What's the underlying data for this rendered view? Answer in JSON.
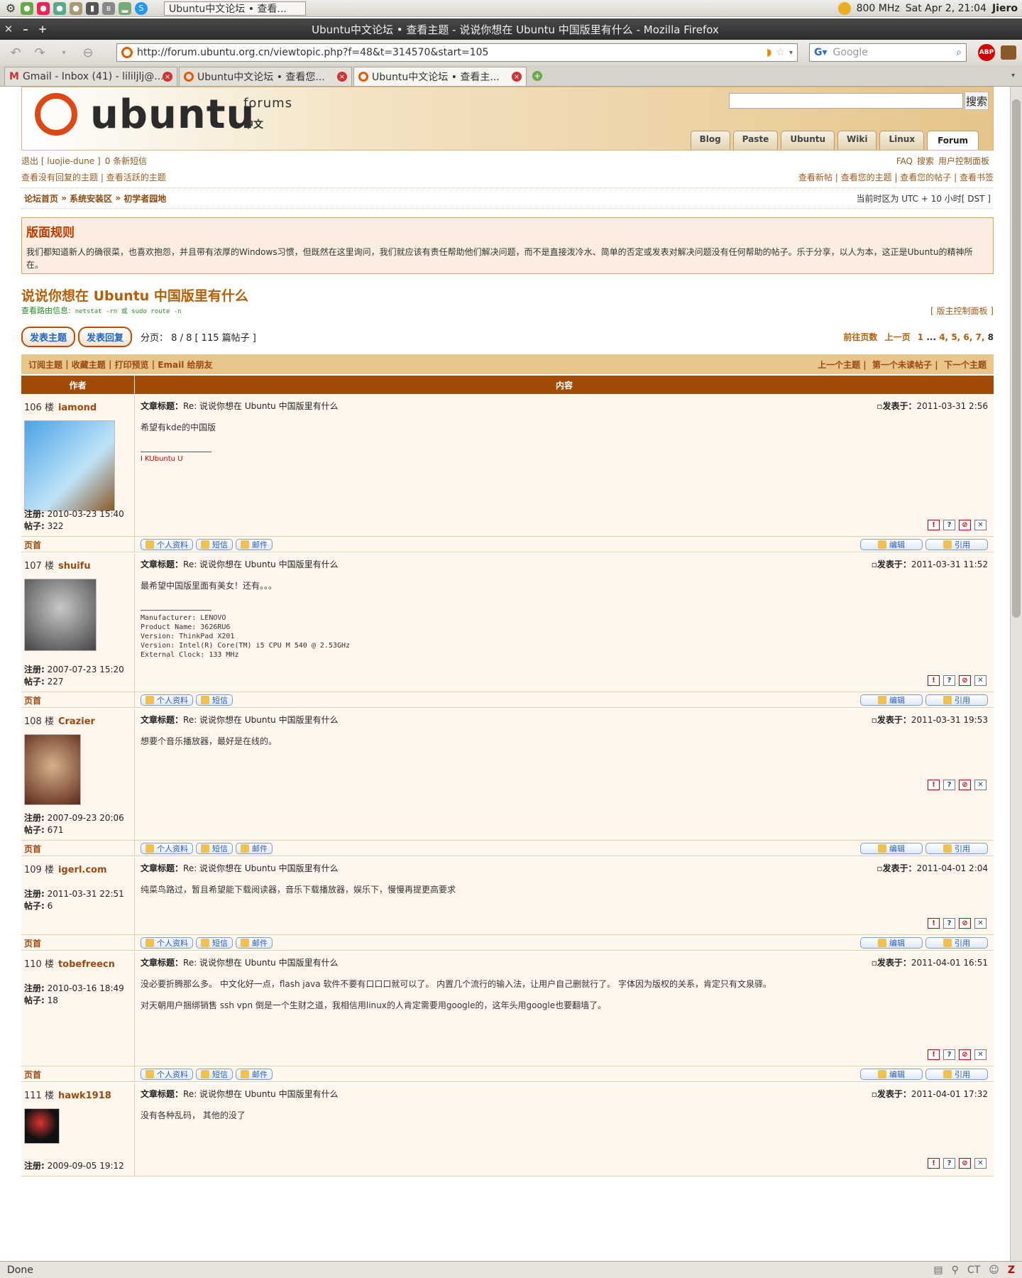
{
  "panel": {
    "task": "Ubuntu中文论坛 • 查看...",
    "cpu": "800 MHz",
    "clock": "Sat Apr  2, 21:04",
    "user": "Jiero"
  },
  "window": {
    "title": "Ubuntu中文论坛 • 查看主题 - 说说你想在 Ubuntu 中国版里有什么 - Mozilla Firefox"
  },
  "browser": {
    "url": "http://forum.ubuntu.org.cn/viewtopic.php?f=48&t=314570&start=105",
    "search_placeholder": "Google",
    "abp": "ABP"
  },
  "tabs": [
    {
      "label": "Gmail - Inbox (41) - lililjlj@..."
    },
    {
      "label": "Ubuntu中文论坛 • 查看您..."
    },
    {
      "label": "Ubuntu中文论坛 • 查看主..."
    }
  ],
  "status": {
    "text": "Done",
    "tz": "CT"
  },
  "header": {
    "logo": "ubuntu",
    "forums": "forums",
    "zh": "中文",
    "search_btn": "搜索",
    "tabs": [
      "Blog",
      "Paste",
      "Ubuntu",
      "Wiki",
      "Linux",
      "Forum"
    ]
  },
  "userbar": {
    "logout": "退出 [ luojie-dune ]",
    "pm": "0 条新短信",
    "faq": "FAQ",
    "search": "搜索",
    "ucp": "用户控制面板"
  },
  "links": {
    "unanswered": "查看没有回复的主题",
    "active": "查看活跃的主题",
    "newposts": "查看新帖",
    "yourtopics": "查看您的主题",
    "yourposts": "查看您的帖子",
    "bookmarks": "查看书签"
  },
  "breadcrumb": {
    "a": "论坛首页",
    "b": "系统安装区",
    "c": "初学者园地",
    "tz": "当前时区为 UTC + 10 小时[ DST ]"
  },
  "rules": {
    "title": "版面规则",
    "text": "我们都知道新人的确很菜，也喜欢抱怨，并且带有浓厚的Windows习惯，但既然在这里询问，我们就应该有责任帮助他们解决问题，而不是直接泼冷水、简单的否定或发表对解决问题没有任何帮助的帖子。乐于分享，以人为本，这正是Ubuntu的精神所在。"
  },
  "topic": {
    "title": "说说你想在 Ubuntu 中国版里有什么",
    "route_label": "查看路由信息:",
    "route_cmd": "netstat -rn 或 sudo route -n",
    "mod": "[ 版主控制面板 ]"
  },
  "pagination": {
    "new_topic": "发表主题",
    "reply": "发表回复",
    "info": "分页： 8 / 8  [ 115 篇帖子 ]",
    "goto": "前往页数",
    "prev": "上一页",
    "pages": [
      "1",
      "...",
      "4,",
      "5,",
      "6,",
      "7,",
      "8"
    ]
  },
  "actions": {
    "sub": "订阅主题",
    "bm": "收藏主题",
    "print": "打印预览",
    "email": "Email 给朋友",
    "prevt": "上一个主题",
    "unread": "第一个未读帖子",
    "nextt": "下一个主题"
  },
  "thead": {
    "author": "作者",
    "content": "内容"
  },
  "post_labels": {
    "subject": "文章标题：",
    "posted": "发表于：",
    "reg": "注册:",
    "posts": "帖子:",
    "top": "页首",
    "profile": "个人资料",
    "pm": "短信",
    "email": "邮件",
    "edit": "编辑",
    "quote": "引用"
  },
  "posts": [
    {
      "floor": "106 楼",
      "user": "iamond",
      "subject": "Re: 说说你想在 Ubuntu 中国版里有什么",
      "time": "2011-03-31 2:56",
      "body": "希望有kde的中国版",
      "sig": "I KUbuntu U",
      "reg": "2010-03-23 15:40",
      "count": "322"
    },
    {
      "floor": "107 楼",
      "user": "shuifu",
      "subject": "Re: 说说你想在 Ubuntu 中国版里有什么",
      "time": "2011-03-31 11:52",
      "body": "最希望中国版里面有美女！还有。。。",
      "sig": "Manufacturer: LENOVO\nProduct Name: 3626RU6\nVersion: ThinkPad X201\nVersion: Intel(R) Core(TM) i5 CPU M 540 @ 2.53GHz\nExternal Clock: 133 MHz",
      "reg": "2007-07-23 15:20",
      "count": "227"
    },
    {
      "floor": "108 楼",
      "user": "Crazier",
      "subject": "Re: 说说你想在 Ubuntu 中国版里有什么",
      "time": "2011-03-31 19:53",
      "body": "想要个音乐播放器，最好是在线的。",
      "reg": "2007-09-23 20:06",
      "count": "671"
    },
    {
      "floor": "109 楼",
      "user": "igerl.com",
      "subject": "Re: 说说你想在 Ubuntu 中国版里有什么",
      "time": "2011-04-01 2:04",
      "body": "纯菜鸟路过，暂且希望能下载阅读器，音乐下载播放器，娱乐下，慢慢再提更高要求",
      "reg": "2011-03-31 22:51",
      "count": "6"
    },
    {
      "floor": "110 楼",
      "user": "tobefreecn",
      "subject": "Re: 说说你想在 Ubuntu 中国版里有什么",
      "time": "2011-04-01 16:51",
      "body": "没必要折腾那么多。 中文化好一点，flash java 软件不要有口口口就可以了。 内置几个流行的输入法，让用户自己删就行了。 字体因为版权的关系，肯定只有文泉驿。",
      "body2": "对天朝用户捆绑销售 ssh vpn 倒是一个生财之道，我相信用linux的人肯定需要用google的，这年头用google也要翻墙了。",
      "reg": "2010-03-16 18:49",
      "count": "18"
    },
    {
      "floor": "111 楼",
      "user": "hawk1918",
      "subject": "Re: 说说你想在 Ubuntu 中国版里有什么",
      "time": "2011-04-01 17:32",
      "body": "没有各种乱码， 其他的没了",
      "reg": "2009-09-05 19:12"
    }
  ]
}
